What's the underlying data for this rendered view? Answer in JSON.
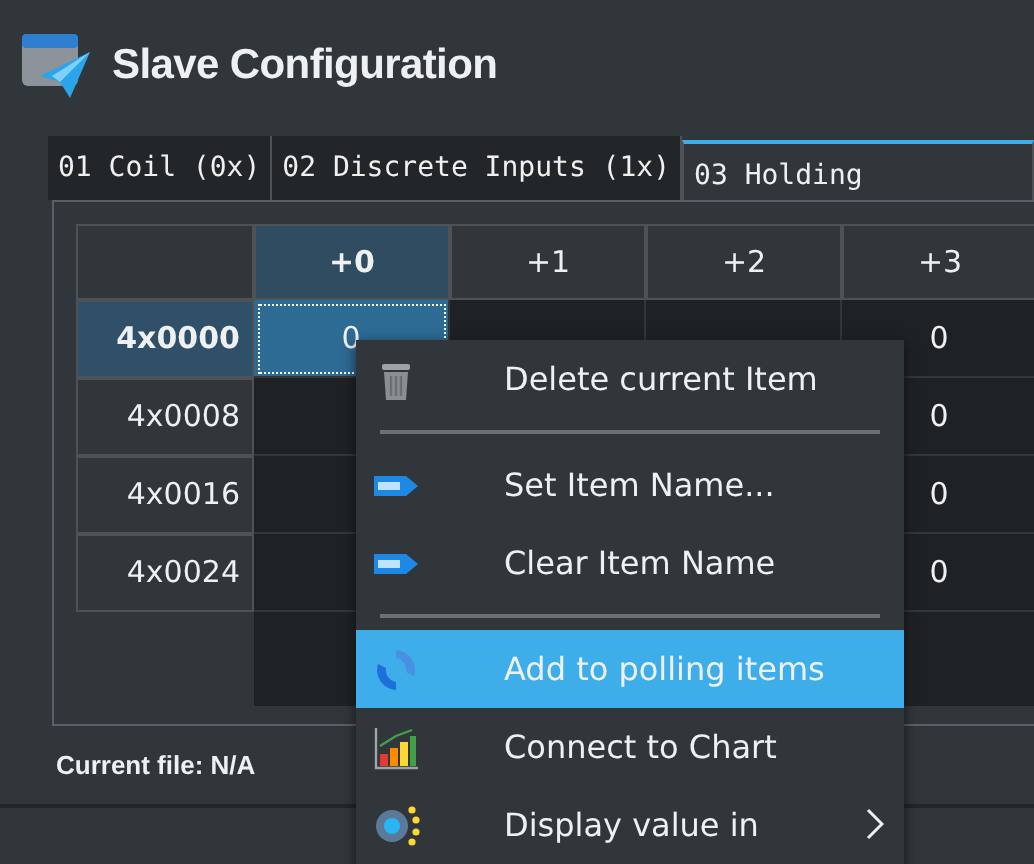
{
  "window": {
    "title": "Slave Configuration"
  },
  "tabs": [
    {
      "label": "01 Coil (0x)",
      "selected": false
    },
    {
      "label": "02 Discrete Inputs (1x)",
      "selected": false
    },
    {
      "label": "03 Holding",
      "selected": true
    }
  ],
  "table": {
    "columns": [
      {
        "label": "+0",
        "selected": true
      },
      {
        "label": "+1",
        "selected": false
      },
      {
        "label": "+2",
        "selected": false
      },
      {
        "label": "+3",
        "selected": false
      }
    ],
    "rows": [
      {
        "address": "4x0000",
        "selected": true,
        "cells": [
          "0",
          null,
          null,
          "0"
        ]
      },
      {
        "address": "4x0008",
        "selected": false,
        "cells": [
          null,
          null,
          null,
          "0"
        ]
      },
      {
        "address": "4x0016",
        "selected": false,
        "cells": [
          null,
          null,
          null,
          "0"
        ]
      },
      {
        "address": "4x0024",
        "selected": false,
        "cells": [
          null,
          null,
          null,
          "0"
        ]
      }
    ]
  },
  "context_menu": {
    "items": [
      {
        "kind": "item",
        "label": "Delete current Item",
        "highlighted": false,
        "submenu": false
      },
      {
        "kind": "separator"
      },
      {
        "kind": "item",
        "label": "Set Item Name...",
        "highlighted": false,
        "submenu": false
      },
      {
        "kind": "item",
        "label": "Clear Item Name",
        "highlighted": false,
        "submenu": false
      },
      {
        "kind": "separator"
      },
      {
        "kind": "item",
        "label": "Add to polling items",
        "highlighted": true,
        "submenu": false
      },
      {
        "kind": "item",
        "label": "Connect to Chart",
        "highlighted": false,
        "submenu": false
      },
      {
        "kind": "item",
        "label": "Display value in",
        "highlighted": false,
        "submenu": true
      }
    ]
  },
  "status_bar": {
    "text": "Current file: N/A"
  }
}
